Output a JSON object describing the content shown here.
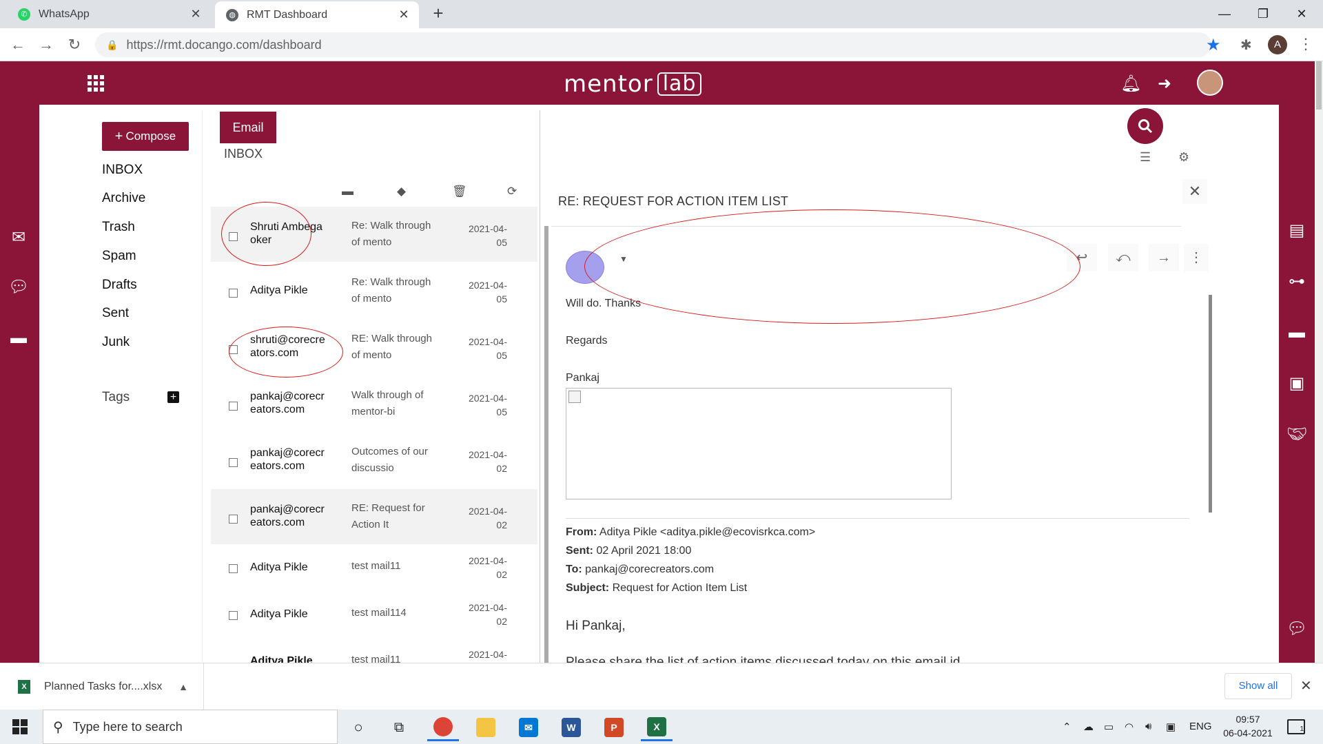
{
  "browser": {
    "tabs": [
      {
        "title": "WhatsApp",
        "favicon": "whatsapp-icon"
      },
      {
        "title": "RMT Dashboard",
        "favicon": "globe-icon"
      }
    ],
    "url": "https://rmt.docango.com/dashboard",
    "profile_initial": "A"
  },
  "app": {
    "logo_text": "mentor",
    "logo_badge": "lab",
    "brand_color": "#8a1538"
  },
  "nav": {
    "compose_label": "Compose",
    "folders": [
      "INBOX",
      "Archive",
      "Trash",
      "Spam",
      "Drafts",
      "Sent",
      "Junk"
    ],
    "tags_label": "Tags"
  },
  "panel": {
    "email_button": "Email",
    "current_folder": "INBOX"
  },
  "emails": [
    {
      "sender": "Shruti Ambegaoker",
      "subject": "Re: Walk through of mento",
      "date": "2021-04-05",
      "highlight": true
    },
    {
      "sender": "Aditya Pikle",
      "subject": "Re: Walk through of mento",
      "date": "2021-04-05",
      "highlight": false
    },
    {
      "sender": "shruti@corecreators.com",
      "subject": "RE: Walk through of mento",
      "date": "2021-04-05",
      "highlight": false
    },
    {
      "sender": "pankaj@corecreators.com",
      "subject": "Walk through of mentor-bi",
      "date": "2021-04-05",
      "highlight": false
    },
    {
      "sender": "pankaj@corecreators.com",
      "subject": "Outcomes of our discussio",
      "date": "2021-04-02",
      "highlight": false
    },
    {
      "sender": "pankaj@corecreators.com",
      "subject": "RE: Request for Action It",
      "date": "2021-04-02",
      "highlight": true
    },
    {
      "sender": "Aditya Pikle",
      "subject": "test mail11",
      "date": "2021-04-02",
      "highlight": false
    },
    {
      "sender": "Aditya Pikle",
      "subject": "test mail114",
      "date": "2021-04-02",
      "highlight": false
    },
    {
      "sender": "Aditya Pikle",
      "subject": "test mail11",
      "date": "2021-04-",
      "highlight": false
    }
  ],
  "reading": {
    "title": "RE: REQUEST FOR ACTION ITEM LIST",
    "body_lines": [
      "Will do. Thanks",
      "Regards",
      "Pankaj"
    ],
    "from_label": "From:",
    "from_value": "Aditya Pikle <aditya.pikle@ecovisrkca.com>",
    "sent_label": "Sent:",
    "sent_value": "02 April 2021 18:00",
    "to_label": "To:",
    "to_value": "pankaj@corecreators.com",
    "subject_label": "Subject:",
    "subject_value": "Request for Action Item List",
    "greeting": "Hi Pankaj,",
    "next_line": "Please share the list of action items discussed today on this email id."
  },
  "downloads": {
    "file_name": "Planned Tasks for....xlsx",
    "show_all": "Show all"
  },
  "taskbar": {
    "search_placeholder": "Type here to search",
    "language": "ENG",
    "time": "09:57",
    "date": "06-04-2021",
    "notifications": "1"
  }
}
